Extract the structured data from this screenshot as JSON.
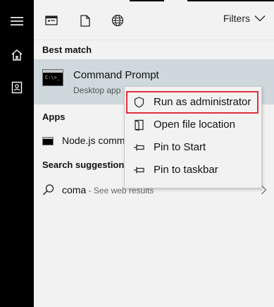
{
  "sidebar": {
    "icons": [
      "hamburger-menu-icon",
      "home-icon",
      "documents-icon"
    ]
  },
  "toolbar": {
    "icons": [
      "apps-filter-icon",
      "documents-filter-icon",
      "web-filter-icon"
    ],
    "filters_label": "Filters"
  },
  "sections": {
    "best_match": "Best match",
    "apps": "Apps",
    "search_suggestions": "Search suggestions"
  },
  "best_match": {
    "title": "Command Prompt",
    "subtitle": "Desktop app",
    "icon": "command-prompt-icon"
  },
  "apps": [
    {
      "label": "Node.js command prompt",
      "icon": "command-prompt-icon"
    }
  ],
  "suggestions": [
    {
      "query": "coma",
      "suffix": " - See web results",
      "icon": "search-icon"
    }
  ],
  "context_menu": {
    "items": [
      {
        "label": "Run as administrator",
        "icon": "shield-icon",
        "highlighted": true
      },
      {
        "label": "Open file location",
        "icon": "open-folder-icon",
        "highlighted": false
      },
      {
        "label": "Pin to Start",
        "icon": "pin-icon",
        "highlighted": false
      },
      {
        "label": "Pin to taskbar",
        "icon": "pin-icon",
        "highlighted": false
      }
    ]
  },
  "colors": {
    "sidebar_bg": "#000000",
    "panel_bg": "#f2f2f2",
    "selected_bg": "#cfd8dc",
    "highlight_outline": "#e03040"
  }
}
